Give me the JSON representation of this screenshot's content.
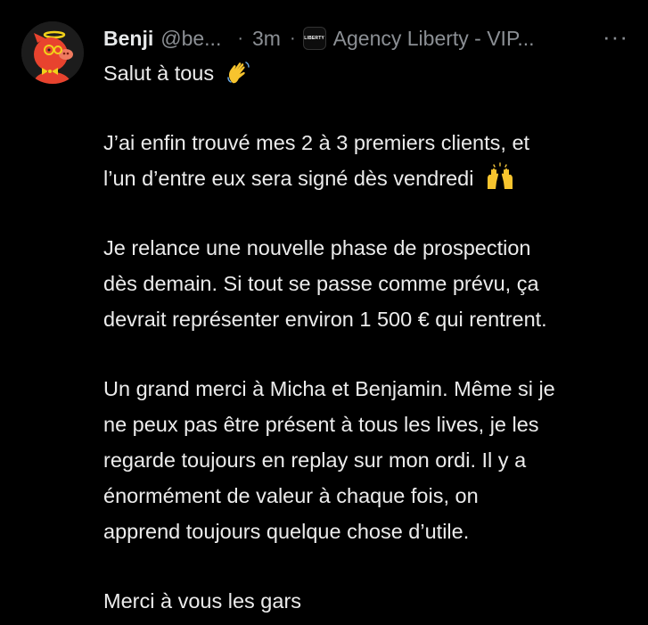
{
  "post": {
    "author_name": "Benji",
    "author_handle": "@be...",
    "separator": "·",
    "time": "3m",
    "community_logo_text": "LIBERTY",
    "community_name": "Agency Liberty - VIP...",
    "more_label": "···",
    "paragraphs": [
      [
        "Salut à tous"
      ],
      [
        "J’ai enfin trouvé mes 2 à 3 premiers clients, et",
        "l’un d’entre eux sera signé dès vendredi"
      ],
      [
        "Je relance une nouvelle phase de prospection",
        "dès demain. Si tout se passe comme prévu, ça",
        "devrait représenter environ 1 500 € qui rentrent."
      ],
      [
        "Un grand merci à Micha et Benjamin. Même si je",
        "ne peux pas être présent à tous les lives, je les",
        "regarde toujours en replay sur mon ordi. Il y a",
        "énormément de valeur à chaque fois, on",
        "apprend toujours quelque chose d’utile."
      ],
      [
        "Merci à vous les gars"
      ]
    ],
    "emojis": {
      "greeting": "waving-hand",
      "celebration": "raising-hands"
    }
  },
  "colors": {
    "background": "#000000",
    "primary_text": "#e7e9ea",
    "secondary_text": "#8b8f94",
    "avatar_bg": "#1c1c1c",
    "avatar_pig": "#e8432e"
  }
}
